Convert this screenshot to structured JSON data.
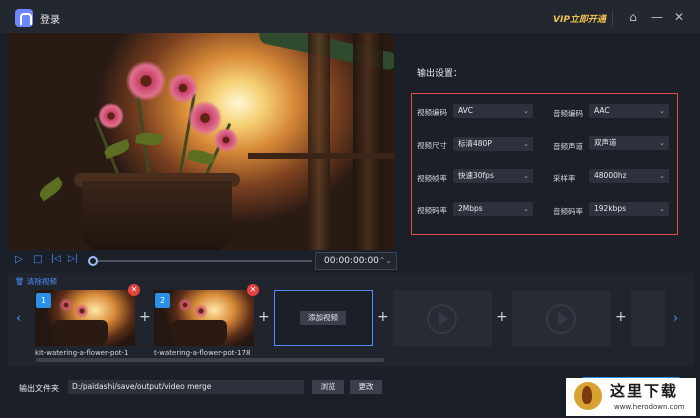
{
  "titlebar": {
    "title": "登录",
    "vip": "VIP立即开通",
    "home_glyph": "⌂",
    "minimize_glyph": "—",
    "close_glyph": "✕"
  },
  "player": {
    "play_glyph": "▷",
    "stop_glyph": "□",
    "prev_glyph": "|◁",
    "next_glyph": "▷|",
    "time": "00:00:00:00",
    "spin_glyph": "⌃⌄",
    "progress": 0
  },
  "settings": {
    "title": "输出设置：",
    "rows": [
      {
        "left_label": "视频编码",
        "left_value": "AVC",
        "right_label": "音频编码",
        "right_value": "AAC"
      },
      {
        "left_label": "视频尺寸",
        "left_value": "标清480P",
        "right_label": "音频声道",
        "right_value": "双声道"
      },
      {
        "left_label": "视频帧率",
        "left_value": "快速30fps",
        "right_label": "采样率",
        "right_value": "48000hz"
      },
      {
        "left_label": "视频码率",
        "left_value": "2Mbps",
        "right_label": "音频码率",
        "right_value": "192kbps"
      }
    ],
    "chevron_glyph": "⌄"
  },
  "clips": {
    "clear_label": "清除视频",
    "items": [
      {
        "index": "1",
        "name": "kit-watering-a-flower-pot-1"
      },
      {
        "index": "2",
        "name": "t-watering-a-flower-pot-178"
      }
    ],
    "add_label": "添加视频",
    "plus_glyph": "+",
    "delete_glyph": "✕",
    "left_arrow": "‹",
    "right_arrow": "›"
  },
  "output": {
    "label": "输出文件夹",
    "path": "D:/paidashi/save/output/video merge",
    "browse_label": "浏览",
    "change_label": "更改"
  },
  "watermark": {
    "text": "这里下载",
    "url": "www.herodown.com"
  },
  "colors": {
    "accent": "#2a8fe6",
    "highlight_border": "#e04a4a",
    "vip": "#f2c04e",
    "background": "#1b1f27"
  }
}
